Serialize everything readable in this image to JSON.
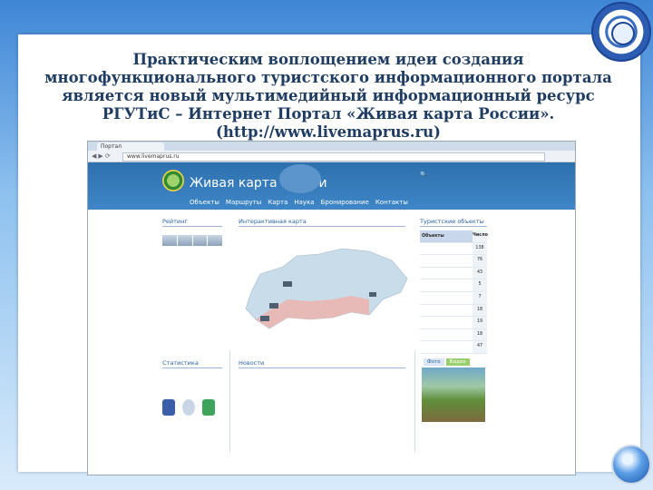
{
  "slide": {
    "title": "Практическим воплощением идеи создания многофункционального туристского информационного портала является новый мультимедийный информационный ресурс РГУТиС – Интернет Портал «Живая карта России». (http://www.livemaprus.ru)"
  },
  "browser": {
    "tab_label": "Портал",
    "url": "www.livemaprus.ru"
  },
  "site": {
    "name": "Живая карта России",
    "menu": [
      "Объекты",
      "Маршруты",
      "Карта",
      "Наука",
      "Бронирование",
      "Контакты"
    ]
  },
  "sections": {
    "rating": "Рейтинг",
    "map": "Интерактивная карта",
    "tourist_objects": "Туристские объекты",
    "statistics": "Статистика",
    "news": "Новости"
  },
  "objects_table": {
    "header": [
      "Объекты",
      "Число"
    ],
    "rows": [
      {
        "name": "",
        "count": "138"
      },
      {
        "name": "",
        "count": "76"
      },
      {
        "name": "",
        "count": "43"
      },
      {
        "name": "",
        "count": "5"
      },
      {
        "name": "",
        "count": "7"
      },
      {
        "name": "",
        "count": "18"
      },
      {
        "name": "",
        "count": "19"
      },
      {
        "name": "",
        "count": "18"
      },
      {
        "name": "",
        "count": "47"
      }
    ]
  },
  "photo_tabs": [
    "Фото",
    "Видео"
  ],
  "colors": {
    "site_header": "#2e70ae",
    "accent_green": "#9acf6d",
    "slide_title": "#1f3d63"
  }
}
